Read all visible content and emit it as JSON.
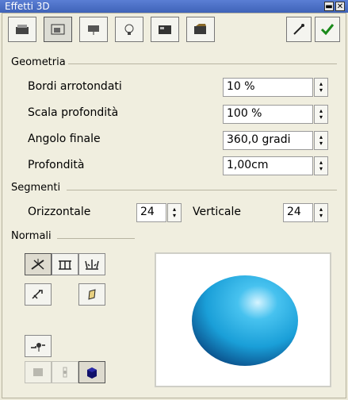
{
  "window": {
    "title": "Effetti 3D",
    "title_buttons": [
      "▬",
      "✕"
    ]
  },
  "toolbar": {
    "tabs": [
      {
        "name": "geometry-tab",
        "icon": "geometry-icon"
      },
      {
        "name": "shading-tab",
        "icon": "shading-icon"
      },
      {
        "name": "illumination-tab",
        "icon": "illumination-icon"
      },
      {
        "name": "light-tab",
        "icon": "light-bulb-icon"
      },
      {
        "name": "textures-tab",
        "icon": "textures-icon"
      },
      {
        "name": "material-tab",
        "icon": "material-icon"
      }
    ],
    "actions": [
      {
        "name": "assign-button",
        "icon": "pipette-icon"
      },
      {
        "name": "apply-button",
        "icon": "checkmark-icon"
      }
    ]
  },
  "geometria": {
    "label": "Geometria",
    "rows": [
      {
        "label": "Bordi arrotondati",
        "value": "10 %"
      },
      {
        "label": "Scala profondità",
        "value": "100 %"
      },
      {
        "label": "Angolo finale",
        "value": "360,0 gradi"
      },
      {
        "label": "Profondità",
        "value": "1,00cm"
      }
    ]
  },
  "segmenti": {
    "label": "Segmenti",
    "orizzontale_label": "Orizzontale",
    "orizzontale_value": "24",
    "verticale_label": "Verticale",
    "verticale_value": "24"
  },
  "normali": {
    "label": "Normali",
    "buttons": [
      {
        "name": "object-specific-button",
        "icon": "object-specific-icon",
        "pressed": true
      },
      {
        "name": "flat-button",
        "icon": "flat-icon",
        "pressed": false
      },
      {
        "name": "spherical-button",
        "icon": "spherical-icon",
        "pressed": false
      },
      {
        "name": "invert-normals-button",
        "icon": "invert-normals-icon",
        "pressed": false
      },
      {
        "name": "double-sided-lighting-button",
        "icon": "double-sided-icon",
        "pressed": false
      }
    ]
  },
  "bottom_buttons": [
    {
      "name": "convert-to-3d-button",
      "icon": "convert-3d-icon"
    },
    {
      "name": "perspective-button",
      "icon": "perspective-icon",
      "disabled": true
    },
    {
      "name": "lathe-button",
      "icon": "lathe-icon",
      "disabled": true
    },
    {
      "name": "shading-preview-button",
      "icon": "cube-icon",
      "pressed": true
    }
  ],
  "preview": {
    "sphere_color": "#1aa6e0"
  }
}
